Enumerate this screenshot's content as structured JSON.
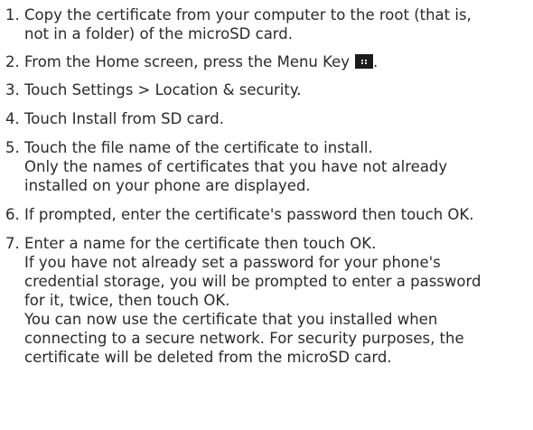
{
  "steps": [
    {
      "number": "1.",
      "lines": [
        [
          {
            "t": "Copy the certificate from your computer to the root (that is,"
          }
        ],
        [
          {
            "t": "not in a folder) of the microSD card."
          }
        ]
      ]
    },
    {
      "number": "2.",
      "lines": [
        [
          {
            "t": "From the Home screen, press the "
          },
          {
            "t": "Menu Key"
          },
          {
            "icon": "menu-key-icon"
          },
          {
            "t": "."
          }
        ]
      ]
    },
    {
      "number": "3.",
      "lines": [
        [
          {
            "t": "Touch "
          },
          {
            "t": "Settings > Location & security"
          },
          {
            "t": "."
          }
        ]
      ]
    },
    {
      "number": "4.",
      "lines": [
        [
          {
            "t": "Touch "
          },
          {
            "t": "Install from SD card"
          },
          {
            "t": "."
          }
        ]
      ]
    },
    {
      "number": "5.",
      "lines": [
        [
          {
            "t": "Touch the file name of the certificate to install."
          }
        ],
        [
          {
            "t": "Only the names of certificates that you have not already"
          }
        ],
        [
          {
            "t": "installed on your phone are displayed."
          }
        ]
      ]
    },
    {
      "number": "6.",
      "lines": [
        [
          {
            "t": "If prompted, enter the certificate's password then touch "
          },
          {
            "t": "OK"
          },
          {
            "t": "."
          }
        ]
      ]
    },
    {
      "number": "7.",
      "lines": [
        [
          {
            "t": "Enter a name for the certificate then touch "
          },
          {
            "t": "OK"
          },
          {
            "t": "."
          }
        ],
        [
          {
            "t": "If you have not already set a password for your phone's"
          }
        ],
        [
          {
            "t": "credential storage, you will be prompted to enter a password"
          }
        ],
        [
          {
            "t": "for it, twice, then touch "
          },
          {
            "t": "OK"
          },
          {
            "t": "."
          }
        ],
        [
          {
            "t": "You can now use the certificate that you installed when"
          }
        ],
        [
          {
            "t": "connecting to a secure network. For security purposes, the"
          }
        ],
        [
          {
            "t": "certificate will be deleted from the microSD card."
          }
        ]
      ]
    }
  ]
}
